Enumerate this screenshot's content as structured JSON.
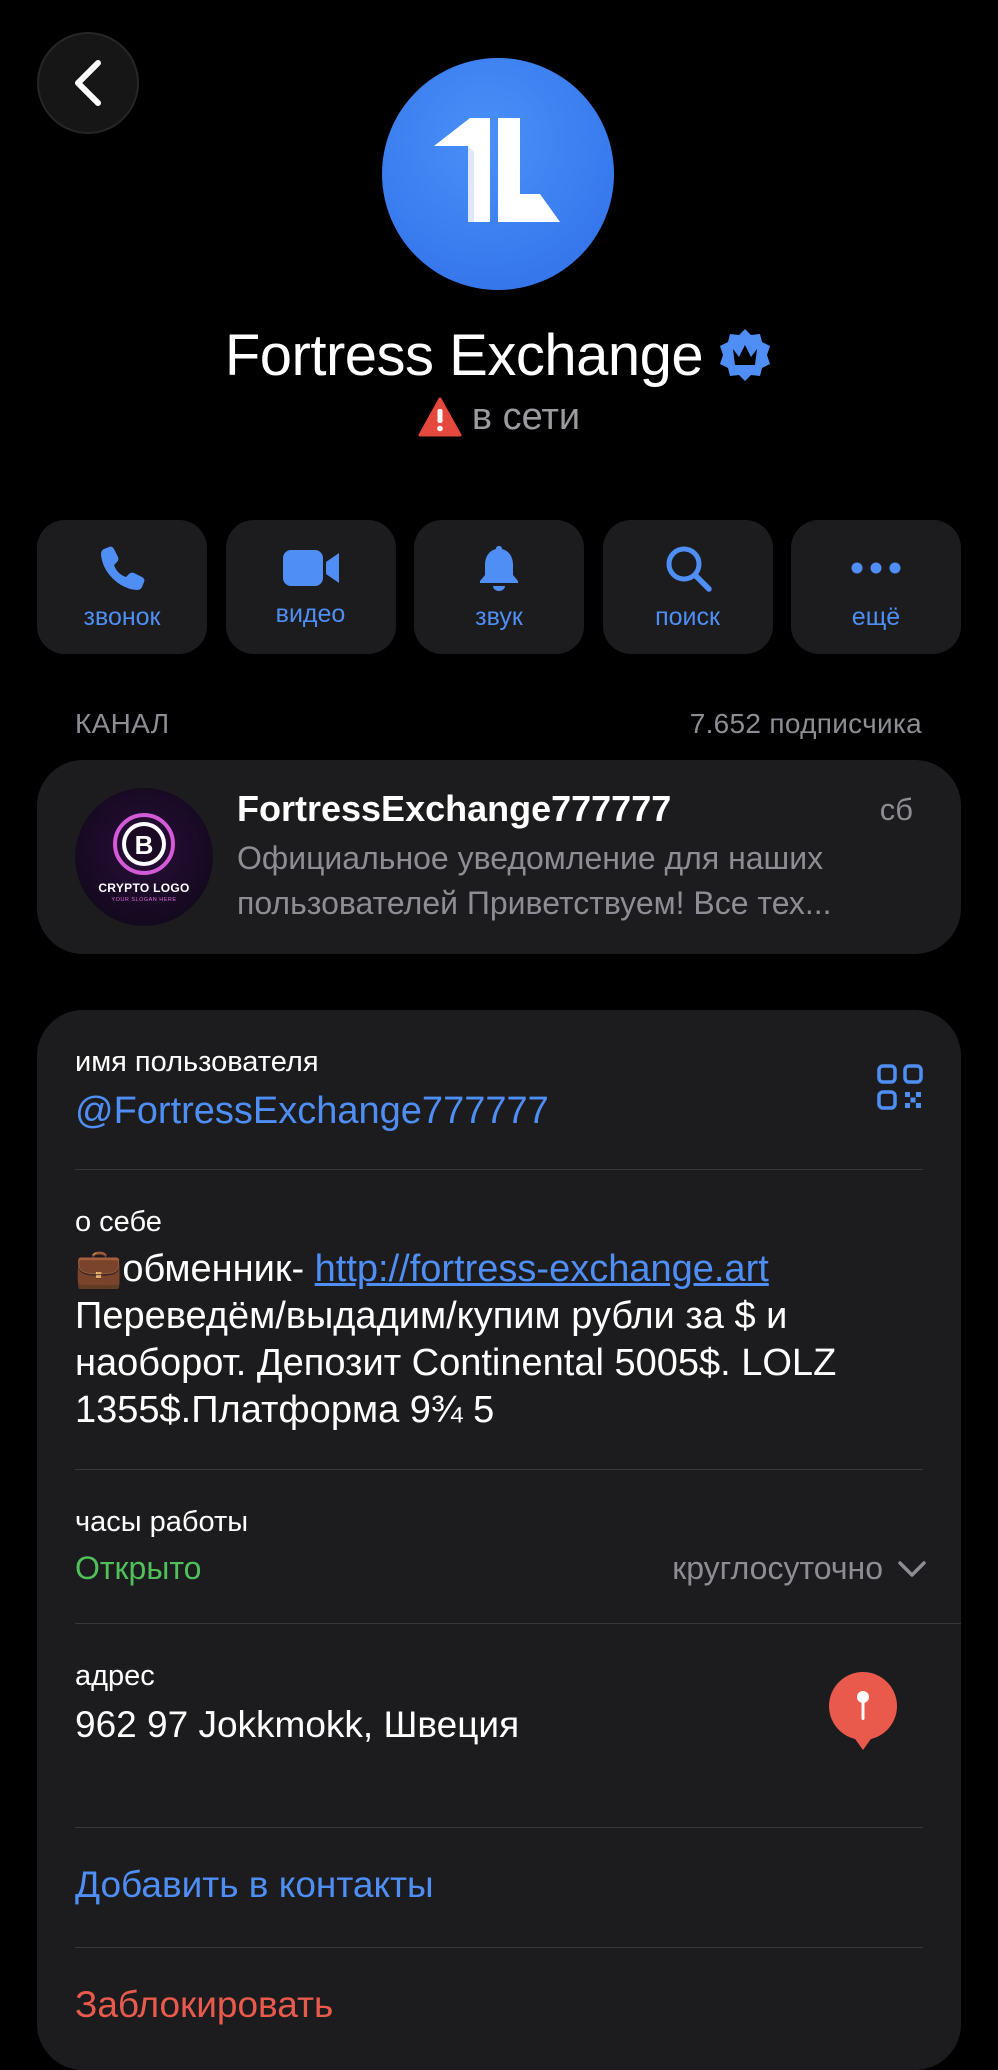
{
  "header": {
    "name": "Fortress Exchange",
    "status": "в сети"
  },
  "actions": [
    {
      "label": "звонок",
      "icon": "phone-icon"
    },
    {
      "label": "видео",
      "icon": "video-icon"
    },
    {
      "label": "звук",
      "icon": "bell-icon"
    },
    {
      "label": "поиск",
      "icon": "search-icon"
    },
    {
      "label": "ещё",
      "icon": "more-icon"
    }
  ],
  "channel": {
    "section_label": "КАНАЛ",
    "subscribers": "7.652 подписчика",
    "title": "FortressExchange777777",
    "day": "сб",
    "preview_line1": "Официальное уведомление для наших",
    "preview_line2": "пользователей Приветствуем! Все тех...",
    "logo_text": "CRYPTO LOGO",
    "logo_sub": "YOUR SLOGAN HERE"
  },
  "info": {
    "username_label": "имя пользователя",
    "username": "@FortressExchange777777",
    "about_label": "о себе",
    "about_prefix": "💼обменник- ",
    "about_link": "http://fortress-exchange.art",
    "about_line2": "Переведём/выдадим/купим рубли за $ и",
    "about_line3": "наоборот. Депозит Continental 5005$. LOLZ",
    "about_line4": "1355$.Платформа 9¾ 5",
    "hours_label": "часы работы",
    "hours_status": "Открыто",
    "hours_value": "круглосуточно",
    "address_label": "адрес",
    "address": "962 97 Jokkmokk, Швеция",
    "add_contact": "Добавить в контакты",
    "block": "Заблокировать"
  },
  "colors": {
    "accent": "#4e8ef5",
    "online_open": "#4fc05a",
    "danger": "#ea5a4c",
    "card_bg": "#1c1c1e"
  }
}
